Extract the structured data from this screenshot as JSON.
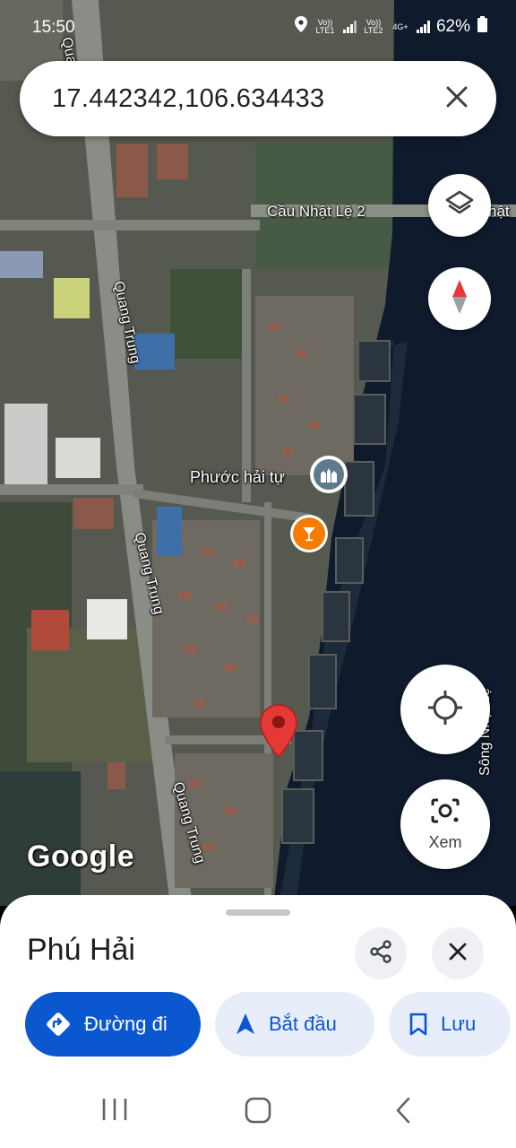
{
  "status_bar": {
    "time": "15:50",
    "sim1_label": "Vo)) LTE1",
    "sim2_label": "Vo)) LTE2",
    "network_type": "4G+",
    "battery": "62%",
    "icons": [
      "location-icon",
      "signal-icon",
      "battery-icon"
    ]
  },
  "search": {
    "query": "17.442342,106.634433"
  },
  "map": {
    "labels": {
      "bridge": "Cầu Nhật Lệ 2",
      "bridge_suffix": "hật",
      "road_top": "Quang Trung",
      "road_top_partial": "Quang",
      "road_mid": "Quang Trung",
      "road_bottom": "Quang Trung",
      "river": "Sông Nhật Lệ",
      "poi_temple": "Phước hải tự",
      "watermark": "Google"
    },
    "poi_icons": [
      "temple-icon",
      "cocktail-bar-icon",
      "red-pin-icon"
    ]
  },
  "controls": {
    "layers_icon": "layers-icon",
    "compass_icon": "compass-icon",
    "location_icon": "my-location-icon",
    "lens_label": "Xem"
  },
  "sheet": {
    "title": "Phú Hải",
    "directions_label": "Đường đi",
    "start_label": "Bắt đầu",
    "save_label": "Lưu"
  },
  "colors": {
    "accent": "#0b57d0",
    "pin": "#e53935",
    "poi_temple": "#5f7a8c",
    "poi_bar": "#f57c00"
  }
}
